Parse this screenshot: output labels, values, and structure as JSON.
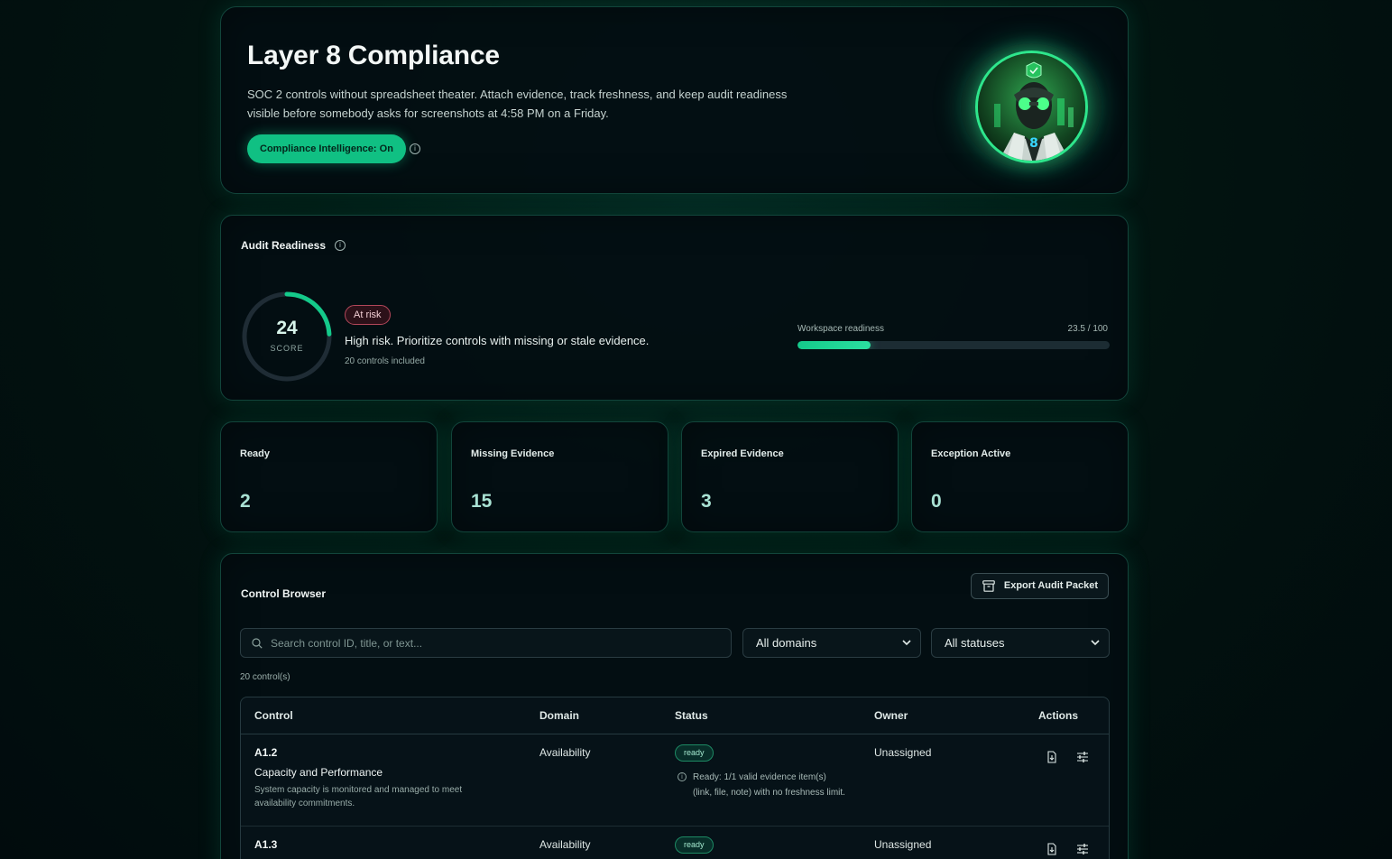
{
  "hero": {
    "title": "Layer 8 Compliance",
    "subtitle": "SOC 2 controls without spreadsheet theater. Attach evidence, track freshness, and keep audit readiness visible before somebody asks for screenshots at 4:58 PM on a Friday.",
    "toggle_label": "Compliance Intelligence: On"
  },
  "audit": {
    "title": "Audit Readiness",
    "score": "24",
    "score_fraction": 0.24,
    "score_label": "SCORE",
    "badge": "At risk",
    "message": "High risk. Prioritize controls with missing or stale evidence.",
    "controls_included": "20 controls included",
    "readiness_label": "Workspace readiness",
    "readiness_value": "23.5 / 100",
    "readiness_fraction": 0.235
  },
  "stats": [
    {
      "label": "Ready",
      "value": "2"
    },
    {
      "label": "Missing Evidence",
      "value": "15"
    },
    {
      "label": "Expired Evidence",
      "value": "3"
    },
    {
      "label": "Exception Active",
      "value": "0"
    }
  ],
  "browser": {
    "title": "Control Browser",
    "export_label": "Export Audit Packet",
    "search_placeholder": "Search control ID, title, or text...",
    "domain_filter": "All domains",
    "status_filter": "All statuses",
    "count": "20 control(s)",
    "columns": {
      "control": "Control",
      "domain": "Domain",
      "status": "Status",
      "owner": "Owner",
      "actions": "Actions"
    },
    "rows": [
      {
        "id": "A1.2",
        "title": "Capacity and Performance",
        "description": "System capacity is monitored and managed to meet availability commitments.",
        "domain": "Availability",
        "status": "ready",
        "status_note": "Ready: 1/1 valid evidence item(s) (link, file, note) with no freshness limit.",
        "owner": "Unassigned"
      },
      {
        "id": "A1.3",
        "title": "",
        "description": "",
        "domain": "Availability",
        "status": "ready",
        "status_note": "",
        "owner": "Unassigned"
      }
    ]
  },
  "colors": {
    "accent": "#10c083",
    "risk": "#b3475a",
    "background": "#010b0d"
  },
  "icons": {
    "info": "info-icon",
    "export": "archive-icon",
    "search": "search-icon",
    "download": "download-file-icon",
    "adjust": "sliders-icon"
  }
}
